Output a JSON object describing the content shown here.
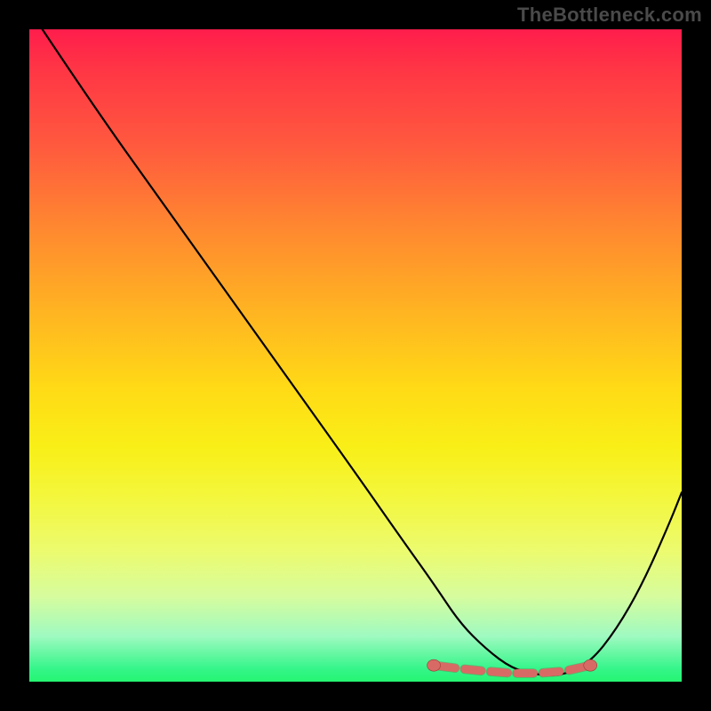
{
  "watermark": "TheBottleneck.com",
  "colors": {
    "frame_bg": "#000000",
    "watermark": "#4a4a4a",
    "curve_stroke": "#000000",
    "marker_fill": "#d86a65",
    "marker_stroke": "#9c3a36",
    "gradient_top": "#ff1d4c",
    "gradient_bottom": "#25f571"
  },
  "chart_data": {
    "type": "line",
    "title": "",
    "xlabel": "",
    "ylabel": "",
    "xlim": [
      0,
      100
    ],
    "ylim": [
      0,
      100
    ],
    "grid": false,
    "legend": null,
    "series": [
      {
        "name": "bottleneck-curve",
        "x": [
          2,
          10,
          20,
          30,
          40,
          50,
          57,
          62,
          66,
          70,
          74,
          78,
          82,
          86,
          90,
          94,
          98,
          100
        ],
        "values": [
          100,
          88,
          74,
          60,
          46,
          32,
          22,
          15,
          9,
          5,
          2,
          1,
          1,
          3,
          8,
          15,
          24,
          29
        ]
      }
    ],
    "markers": {
      "name": "optimal-range",
      "style": "dotted-pill",
      "x": [
        62,
        66,
        70,
        74,
        78,
        82,
        86
      ],
      "values": [
        2.5,
        2.0,
        1.6,
        1.3,
        1.3,
        1.6,
        2.5
      ],
      "endpoints": {
        "left": 62,
        "right": 86
      }
    }
  }
}
